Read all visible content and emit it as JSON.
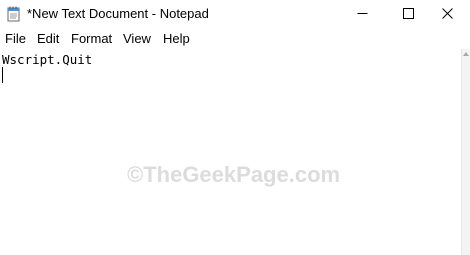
{
  "window": {
    "title": "*New Text Document - Notepad",
    "icon": "notepad-icon"
  },
  "window_controls": {
    "minimize_icon": "minimize-icon",
    "maximize_icon": "maximize-icon",
    "close_icon": "close-icon"
  },
  "menu": {
    "items": [
      {
        "label": "File"
      },
      {
        "label": "Edit"
      },
      {
        "label": "Format"
      },
      {
        "label": "View"
      },
      {
        "label": "Help"
      }
    ]
  },
  "editor": {
    "content": "Wscript.Quit"
  },
  "watermark": {
    "text": "©TheGeekPage.com"
  },
  "colors": {
    "background": "#ffffff",
    "text": "#000000",
    "watermark": "#dcdcdc"
  }
}
